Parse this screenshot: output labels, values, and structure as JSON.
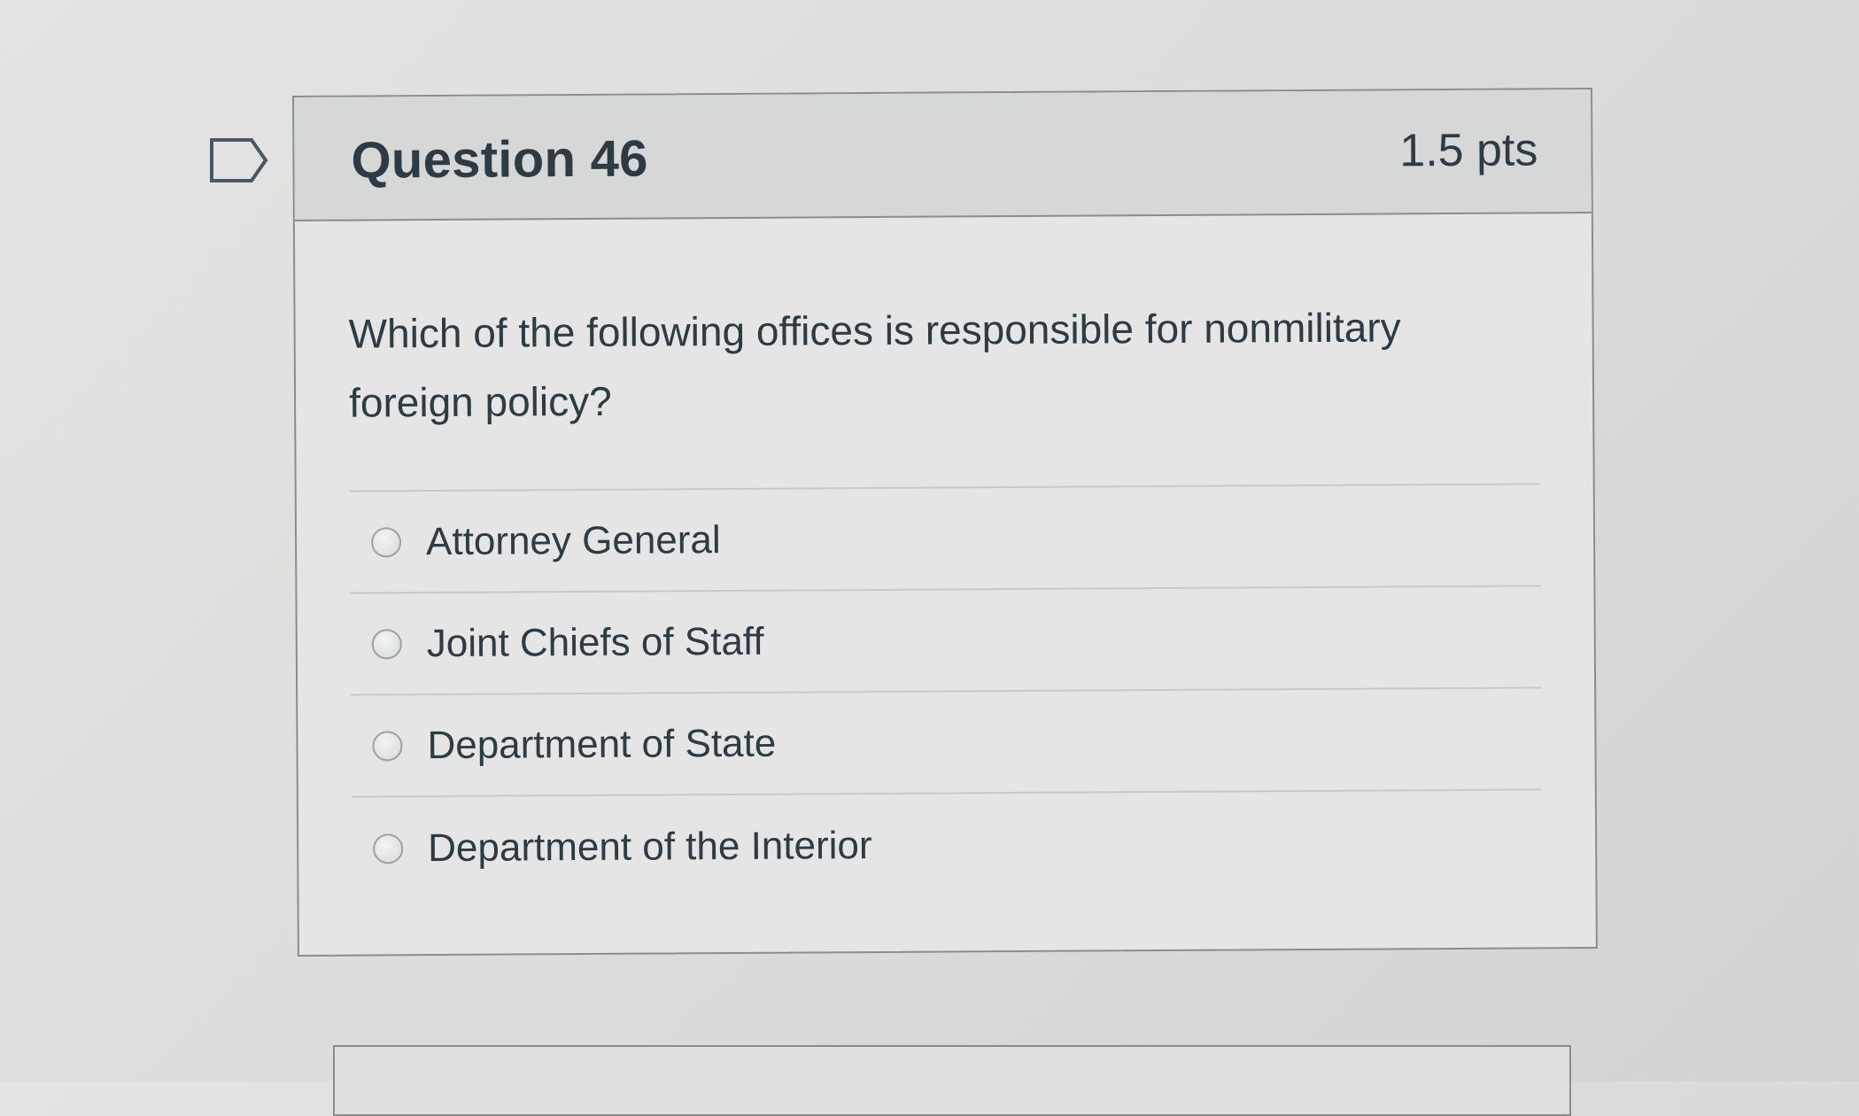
{
  "question": {
    "title": "Question 46",
    "points": "1.5 pts",
    "text": "Which of the following offices is responsible for nonmilitary foreign policy?",
    "answers": [
      {
        "label": "Attorney General",
        "selected": false
      },
      {
        "label": "Joint Chiefs of Staff",
        "selected": false
      },
      {
        "label": "Department of State",
        "selected": false
      },
      {
        "label": "Department of the Interior",
        "selected": false
      }
    ]
  },
  "icons": {
    "flag": "flag-question-icon"
  }
}
